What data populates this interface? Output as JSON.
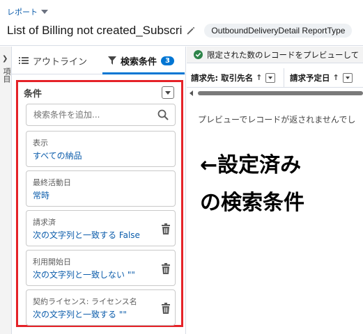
{
  "header": {
    "object_label": "レポート",
    "title": "List of Billing not created_Subscri",
    "report_type_badge": "OutboundDeliveryDetail ReportType"
  },
  "left_rail": {
    "label": "項目"
  },
  "panel": {
    "tabs": [
      {
        "label": "アウトライン",
        "icon": "list-icon"
      },
      {
        "label": "検索条件",
        "icon": "filter-icon",
        "count": "3"
      }
    ],
    "conditions_header": "条件",
    "search": {
      "placeholder": "検索条件を追加..."
    },
    "filters": [
      {
        "label": "表示",
        "value": "すべての納品",
        "removable": false
      },
      {
        "label": "最終活動日",
        "value": "常時",
        "removable": false
      },
      {
        "label": "請求済",
        "value": "次の文字列と一致する False",
        "removable": true
      },
      {
        "label": "利用開始日",
        "value": "次の文字列と一致しない \"\"",
        "removable": true
      },
      {
        "label": "契約ライセンス: ライセンス名",
        "value": "次の文字列と一致する \"\"",
        "removable": true
      }
    ]
  },
  "preview": {
    "notice": "限定された数のレコードをプレビューして",
    "columns": [
      {
        "label": "請求先: 取引先名"
      },
      {
        "label": "請求予定日"
      }
    ],
    "empty_message": "プレビューでレコードが返されませんでし"
  },
  "annotation": {
    "line1": "←設定済み",
    "line2": "の検索条件"
  },
  "colors": {
    "brand_blue": "#0176d3",
    "link_blue": "#0b5cab",
    "highlight_red": "#e52228",
    "success_green": "#2e844a"
  }
}
